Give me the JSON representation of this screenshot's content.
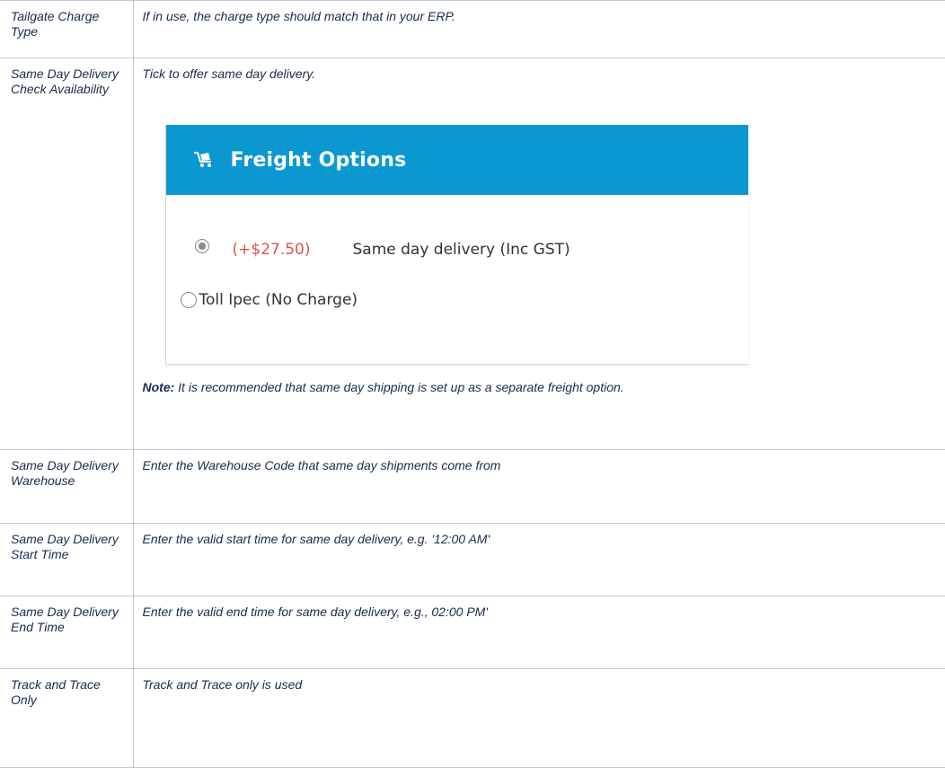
{
  "rows": [
    {
      "field": "Tailgate Charge Type",
      "description": "If in use, the charge type should match that in your ERP."
    },
    {
      "field": "Same Day Delivery Check Availability",
      "description": "Tick to offer same day delivery.",
      "note_label": "Note:",
      "note_text": " It is recommended that same day shipping is set up as a separate freight option."
    },
    {
      "field": "Same Day Delivery Warehouse",
      "description": "Enter the Warehouse Code that same day shipments come from"
    },
    {
      "field": "Same Day Delivery Start Time",
      "description": "Enter the valid start time for same day delivery, e.g. '12:00 AM'"
    },
    {
      "field": "Same Day Delivery End Time",
      "description": "Enter the valid end time for same day delivery, e.g., 02:00 PM'"
    },
    {
      "field": "Track and Trace Only",
      "description": "Track and Trace only is used"
    }
  ],
  "freight_panel": {
    "title": "Freight Options",
    "header_color": "#0b98d1",
    "icon": "truck-icon",
    "options": [
      {
        "price": "(+$27.50)",
        "label": "Same day delivery (Inc GST)",
        "selected": true
      },
      {
        "label": "Toll Ipec (No Charge)",
        "selected": false
      }
    ],
    "price_color": "#d9534f"
  }
}
